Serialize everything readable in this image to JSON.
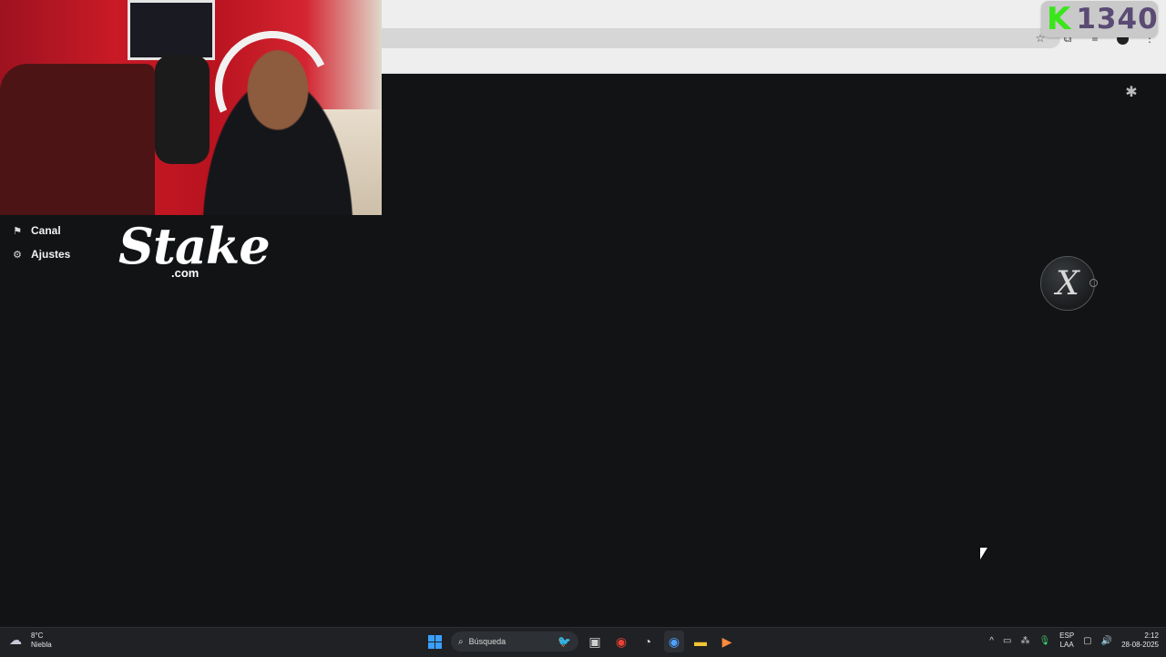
{
  "score_badge": {
    "letter": "K",
    "value": "1340"
  },
  "sidebar": {
    "items": [
      {
        "label": "Canal",
        "icon": "broadcast-icon"
      },
      {
        "label": "Ajustes",
        "icon": "gear-icon"
      }
    ]
  },
  "logo": {
    "word": "Stake",
    "suffix": ".com"
  },
  "taskbar": {
    "weather": {
      "temp": "8°C",
      "condition": "Niebla"
    },
    "search_placeholder": "Búsqueda",
    "language": {
      "code": "ESP",
      "layout": "LAA"
    },
    "clock": {
      "time": "2:12",
      "date": "28-08-2025"
    }
  },
  "colors": {
    "background": "#111315",
    "score_letter": "#39e61a",
    "score_value": "#5a4a74",
    "taskbar": "#1f2124"
  }
}
